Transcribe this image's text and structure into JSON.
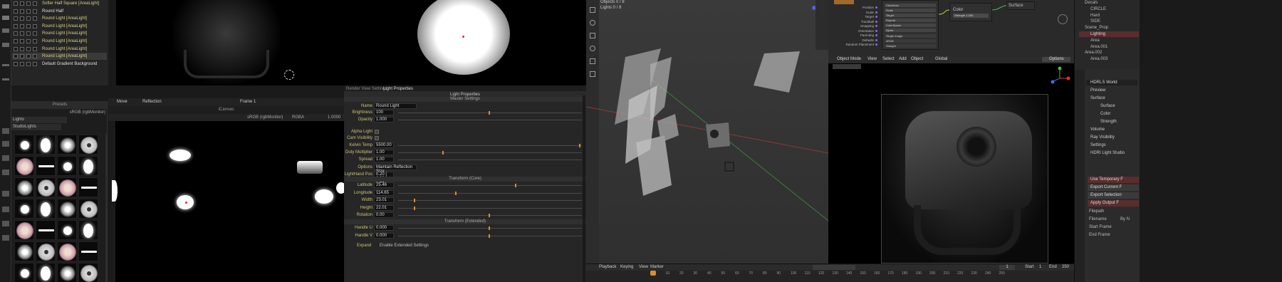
{
  "hdrlight": {
    "layers": [
      "Softer Half Square [AreaLight]",
      "Round Half",
      "Round Light [AreaLight]",
      "Round Light [AreaLight]",
      "Round Light [AreaLight]",
      "Round Light [AreaLight]",
      "Round Light [AreaLight]",
      "Round Light [AreaLight]",
      "Default Gradient Background"
    ],
    "presets_title": "Presets",
    "colorspace": "sRGB (rgbMonitor)",
    "lights_dd": "Lights",
    "studio_dd": "StudioLights",
    "view_tabs": [
      "Move",
      "Reflection"
    ],
    "frame": "Frame 1",
    "canvas_title": "iCanvas",
    "canvas_colorspace": "sRGB (rgbMonitor)",
    "canvas_mode": "RGBA",
    "canvas_val": "1.0000",
    "props_tabs": [
      "Render View Settings",
      "Light Properties"
    ],
    "props_title": "Light Properties",
    "sec_master": "Master Settings",
    "sec_transform": "Transform (Core)",
    "sec_transform_ext": "Transform (Extended)",
    "fields": [
      {
        "label": "Name",
        "value": "Round Light"
      },
      {
        "label": "Brightness",
        "value": "100"
      },
      {
        "label": "Opacity",
        "value": "1.000"
      },
      {
        "label": "Alpha Light",
        "value": ""
      },
      {
        "label": "Cam Visibility",
        "value": ""
      },
      {
        "label": "Kelvin Temp",
        "value": "5500.00"
      },
      {
        "label": "Duty Multiplier",
        "value": "1.00"
      },
      {
        "label": "Spread",
        "value": "1.00"
      },
      {
        "label": "Options",
        "value": "Maintain Reflection Size"
      },
      {
        "label": "LightHand Pos",
        "value": "0.20 | 0.32 | 0.56"
      }
    ],
    "transform": [
      {
        "label": "Latitude",
        "value": "25.46"
      },
      {
        "label": "Longitude",
        "value": "114.65"
      },
      {
        "label": "Width",
        "value": "23.01"
      },
      {
        "label": "Height",
        "value": "22.01"
      },
      {
        "label": "Rotation",
        "value": "0.00"
      }
    ],
    "transform_ext": [
      {
        "label": "Handle U",
        "value": "0.000"
      },
      {
        "label": "Handle V",
        "value": "0.000"
      }
    ],
    "footer_label": "Expand",
    "footer_value": "Enable Extended Settings"
  },
  "blender": {
    "stats": [
      "Objects  0 / 8",
      "Lights   0 / 8"
    ],
    "node_labels": [
      "Position",
      "Scale",
      "Target",
      "Trackball",
      "Snapping",
      "Orientation",
      "Parenting",
      "Defaults",
      "Random Placement"
    ],
    "node_vals": [
      "Checkbox",
      "Scale",
      "Target",
      "Repeat",
      "ColorSpace",
      "Alpha"
    ],
    "node_sel": [
      "Single Image",
      "sRGB",
      "Straight"
    ],
    "node_extra": [
      "Color",
      "Strength 1.000",
      "Surface"
    ],
    "viewport_header": [
      "Object Mode",
      "View",
      "Select",
      "Add",
      "Object",
      "Global"
    ],
    "outliner": [
      "Decals",
      "CIRCLE",
      "Hard",
      "SIDE",
      "Scene_Prop",
      "Lighting",
      "Area",
      "Area.001",
      "Area.002",
      "Area.003"
    ],
    "world": "HDRLS World",
    "props_items": [
      "Preview",
      "Surface",
      "Surface",
      "Color",
      "Strength",
      "Volume",
      "Ray Visibility",
      "Settings",
      "HDRI Light Studio"
    ],
    "export_btns": [
      "Use Temporary F",
      "Export Current F",
      "Export Selection",
      "Apply Output F"
    ],
    "extra_labels": [
      "Filepath",
      "Filename",
      "By N",
      "Start Frame",
      "End Frame"
    ],
    "options": "Options",
    "timeline": {
      "menus": [
        "Playback",
        "Keying",
        "View",
        "Marker"
      ],
      "frame": "1",
      "start": "Start",
      "start_val": "1",
      "end": "End",
      "end_val": "250",
      "ticks": [
        "0",
        "10",
        "20",
        "30",
        "40",
        "50",
        "60",
        "70",
        "80",
        "90",
        "100",
        "110",
        "120",
        "130",
        "140",
        "150",
        "160",
        "170",
        "180",
        "190",
        "200",
        "210",
        "220",
        "230",
        "240",
        "250"
      ]
    }
  },
  "colors": {
    "accent": "#e08a30",
    "label": "#c9c27a",
    "red": "#e03030",
    "selected": "#c05050"
  }
}
